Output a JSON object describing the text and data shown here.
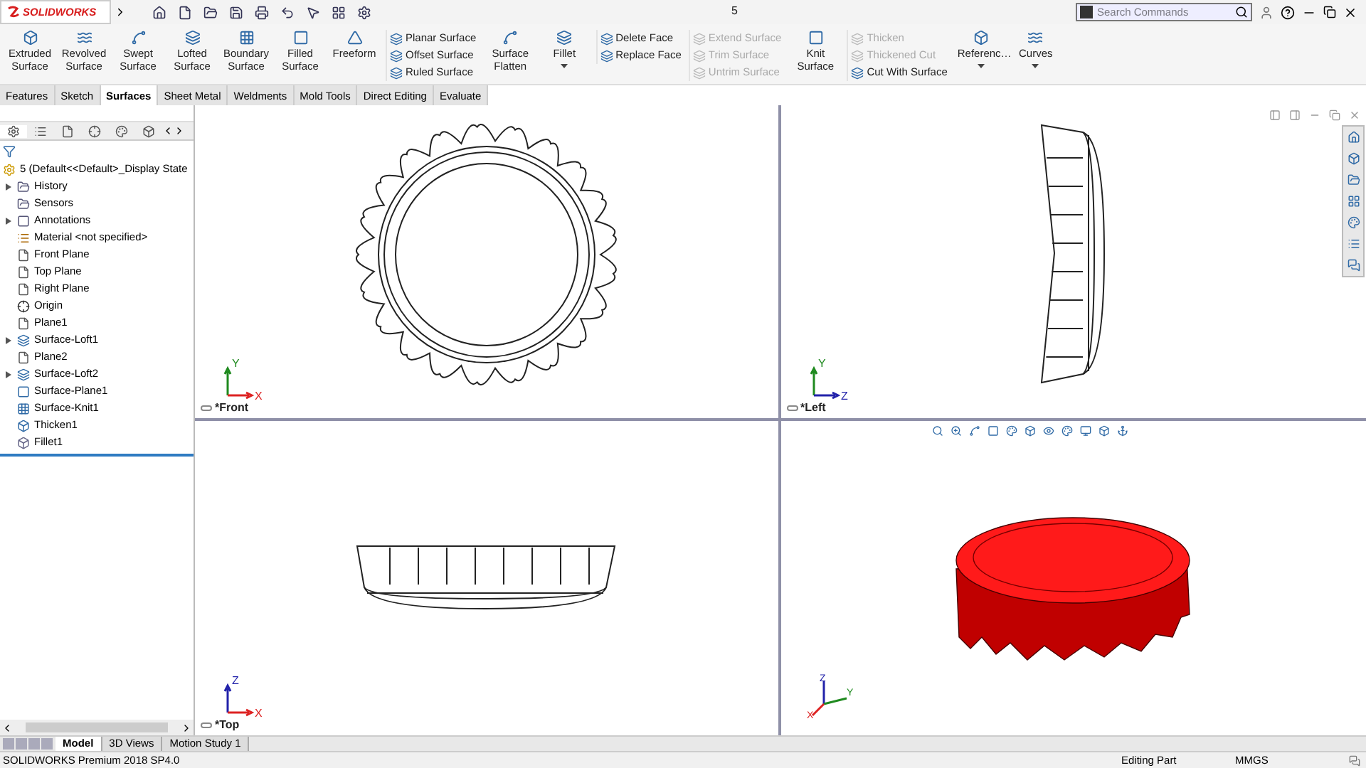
{
  "title_bar": {
    "logo": "SOLIDWORKS",
    "document": "5",
    "search": {
      "placeholder": "Search Commands"
    }
  },
  "ribbon": [
    {
      "kind": "large",
      "items": [
        {
          "label": "Extruded Surface",
          "disabled": false,
          "has_menu": false
        },
        {
          "label": "Revolved Surface",
          "disabled": false,
          "has_menu": false
        },
        {
          "label": "Swept Surface",
          "disabled": false,
          "has_menu": false
        },
        {
          "label": "Lofted Surface",
          "disabled": false,
          "has_menu": false
        },
        {
          "label": "Boundary Surface",
          "disabled": false,
          "has_menu": false
        },
        {
          "label": "Filled Surface",
          "disabled": false,
          "has_menu": false
        },
        {
          "label": "Freeform",
          "disabled": false,
          "has_menu": false
        }
      ]
    },
    {
      "kind": "stack",
      "items": [
        {
          "label": "Planar Surface",
          "disabled": false
        },
        {
          "label": "Offset Surface",
          "disabled": false
        },
        {
          "label": "Ruled Surface",
          "disabled": false
        }
      ]
    },
    {
      "kind": "large",
      "items": [
        {
          "label": "Surface Flatten",
          "disabled": false,
          "has_menu": false
        },
        {
          "label": "Fillet",
          "disabled": false,
          "has_menu": true
        }
      ]
    },
    {
      "kind": "stack",
      "items": [
        {
          "label": "Delete Face",
          "disabled": false
        },
        {
          "label": "Replace Face",
          "disabled": false
        }
      ]
    },
    {
      "kind": "stack",
      "items": [
        {
          "label": "Extend Surface",
          "disabled": true
        },
        {
          "label": "Trim Surface",
          "disabled": true
        },
        {
          "label": "Untrim Surface",
          "disabled": true
        }
      ]
    },
    {
      "kind": "large",
      "items": [
        {
          "label": "Knit Surface",
          "disabled": false,
          "has_menu": false
        }
      ]
    },
    {
      "kind": "stack",
      "items": [
        {
          "label": "Thicken",
          "disabled": true
        },
        {
          "label": "Thickened Cut",
          "disabled": true
        },
        {
          "label": "Cut With Surface",
          "disabled": false
        }
      ]
    },
    {
      "kind": "large",
      "items": [
        {
          "label": "Referenc…",
          "disabled": false,
          "has_menu": true
        },
        {
          "label": "Curves",
          "disabled": false,
          "has_menu": true
        }
      ]
    }
  ],
  "tabs": [
    {
      "label": "Features",
      "selected": false
    },
    {
      "label": "Sketch",
      "selected": false
    },
    {
      "label": "Surfaces",
      "selected": true
    },
    {
      "label": "Sheet Metal",
      "selected": false
    },
    {
      "label": "Weldments",
      "selected": false
    },
    {
      "label": "Mold Tools",
      "selected": false
    },
    {
      "label": "Direct Editing",
      "selected": false
    },
    {
      "label": "Evaluate",
      "selected": false
    }
  ],
  "feature_tree": {
    "root": "5  (Default<<Default>_Display State",
    "items": [
      {
        "label": "History",
        "kind": "folder",
        "expanded": false
      },
      {
        "label": "Sensors",
        "kind": "folder"
      },
      {
        "label": "Annotations",
        "kind": "annotation",
        "expanded": false
      },
      {
        "label": "Material <not specified>",
        "kind": "material"
      },
      {
        "label": "Front Plane",
        "kind": "plane"
      },
      {
        "label": "Top Plane",
        "kind": "plane"
      },
      {
        "label": "Right Plane",
        "kind": "plane"
      },
      {
        "label": "Origin",
        "kind": "origin"
      },
      {
        "label": "Plane1",
        "kind": "plane"
      },
      {
        "label": "Surface-Loft1",
        "kind": "loft",
        "expanded": false
      },
      {
        "label": "Plane2",
        "kind": "plane"
      },
      {
        "label": "Surface-Loft2",
        "kind": "loft",
        "expanded": false
      },
      {
        "label": "Surface-Plane1",
        "kind": "surface"
      },
      {
        "label": "Surface-Knit1",
        "kind": "knit"
      },
      {
        "label": "Thicken1",
        "kind": "thicken"
      },
      {
        "label": "Fillet1",
        "kind": "fillet"
      }
    ]
  },
  "viewports": [
    {
      "kind": "front",
      "label": "*Front",
      "triad": [
        "Y",
        "X"
      ]
    },
    {
      "kind": "left",
      "label": "*Left",
      "triad": [
        "Y",
        "Z"
      ]
    },
    {
      "kind": "top",
      "label": "*Top",
      "triad": [
        "Z",
        "X"
      ]
    },
    {
      "kind": "iso",
      "triad": [
        "Z",
        "Y",
        "X"
      ]
    }
  ],
  "bottom_tabs": [
    {
      "label": "Model",
      "selected": true
    },
    {
      "label": "3D Views",
      "selected": false
    },
    {
      "label": "Motion Study 1",
      "selected": false
    }
  ],
  "status_bar": {
    "product": "SOLIDWORKS Premium 2018 SP4.0",
    "mode": "Editing Part",
    "units": "MMGS"
  }
}
